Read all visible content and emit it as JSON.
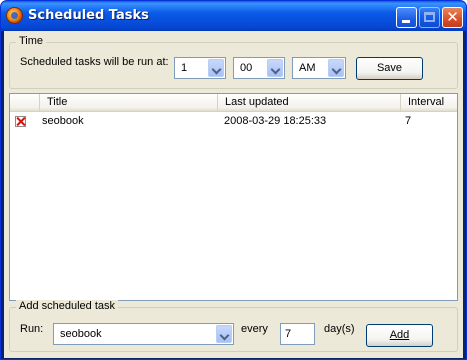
{
  "window": {
    "title": "Scheduled Tasks"
  },
  "time_group": {
    "legend": "Time",
    "run_label": "Scheduled tasks will be run at:",
    "hour": "1",
    "minute": "00",
    "ampm": "AM",
    "save_label": "Save"
  },
  "task_list": {
    "columns": [
      "",
      "Title",
      "Last updated",
      "Interval"
    ],
    "rows": [
      {
        "title": "seobook",
        "last_updated": "2008-03-29 18:25:33",
        "interval": "7"
      }
    ]
  },
  "add_group": {
    "legend": "Add scheduled task",
    "run_label": "Run:",
    "run_value": "seobook",
    "every_label": "every",
    "interval_value": "7",
    "unit_label": "day(s)",
    "add_label": "Add"
  },
  "colors": {
    "titlebar": "#0a5ae8",
    "client_bg": "#ece9d8",
    "close_button": "#d5502c",
    "delete_icon": "#d4140e"
  },
  "icons": [
    "firefox-icon",
    "minimize-icon",
    "maximize-icon",
    "close-icon",
    "delete-task-icon",
    "chevron-down-icon"
  ]
}
